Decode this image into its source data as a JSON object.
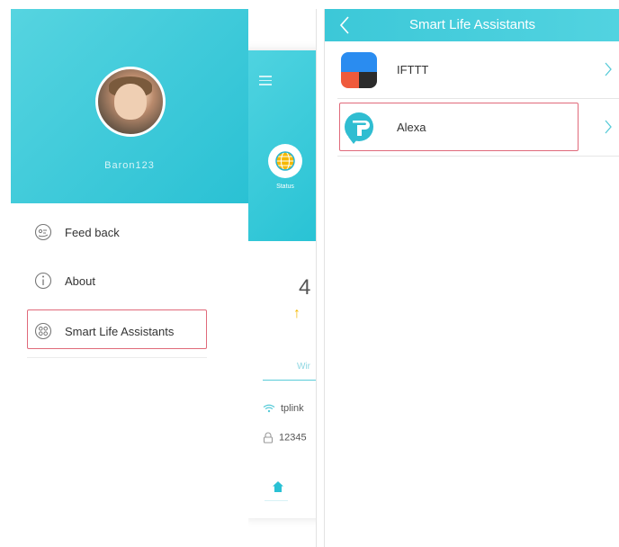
{
  "left": {
    "username": "Baron123",
    "drawer_items": [
      {
        "label": "Feed back",
        "icon": "feedback-icon"
      },
      {
        "label": "About",
        "icon": "info-icon"
      },
      {
        "label": "Smart Life Assistants",
        "icon": "smart-life-icon"
      }
    ],
    "background": {
      "status_label": "Status",
      "big_number": "4",
      "tab_label": "Wir",
      "wifi_name": "tplink",
      "password": "12345"
    }
  },
  "right": {
    "title": "Smart Life Assistants",
    "items": [
      {
        "label": "IFTTT",
        "icon": "ifttt-logo-icon"
      },
      {
        "label": "Alexa",
        "icon": "tplink-alexa-logo-icon"
      }
    ]
  },
  "colors": {
    "accent": "#3cc8d8",
    "highlight_box": "#e06a7a",
    "arrow": "#f5b800"
  }
}
